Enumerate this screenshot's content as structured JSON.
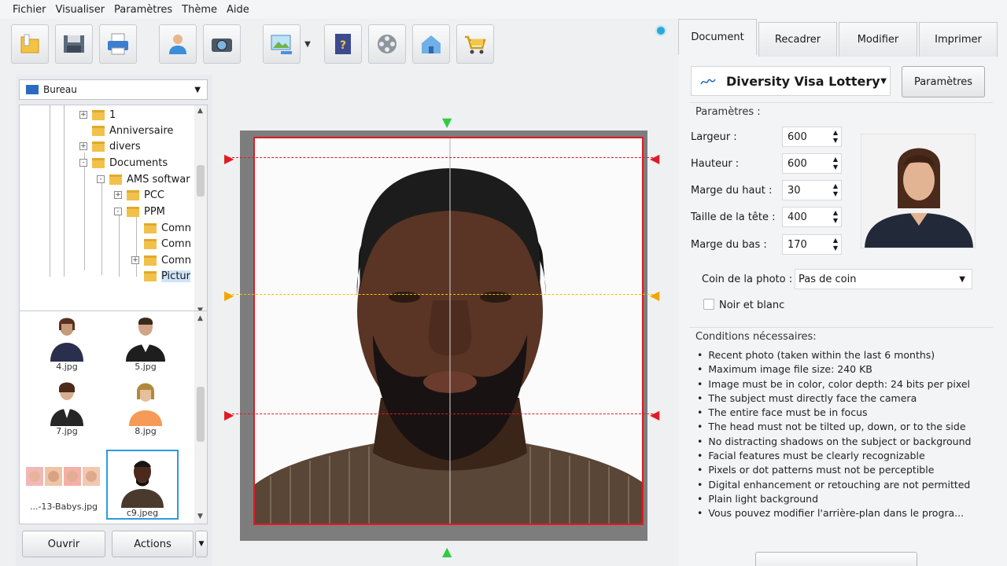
{
  "menu": [
    "Fichier",
    "Visualiser",
    "Paramètres",
    "Thème",
    "Aide"
  ],
  "toolbar": {
    "buttons": [
      "open-folder-icon",
      "save-icon",
      "print-icon",
      "person-icon",
      "camera-icon",
      "photo-edit-icon",
      "help-book-icon",
      "film-reel-icon",
      "home-icon",
      "cart-icon"
    ]
  },
  "left": {
    "location": "Bureau",
    "tree": [
      {
        "label": "1",
        "pm": "+"
      },
      {
        "label": "Anniversaire",
        "pm": ""
      },
      {
        "label": "divers",
        "pm": "+"
      },
      {
        "label": "Documents",
        "pm": "-"
      },
      {
        "label": "AMS softwar",
        "pm": "-"
      },
      {
        "label": "PCC",
        "pm": "+"
      },
      {
        "label": "PPM",
        "pm": "-"
      },
      {
        "label": "Comn",
        "pm": ""
      },
      {
        "label": "Comn",
        "pm": ""
      },
      {
        "label": "Comn",
        "pm": "+"
      },
      {
        "label": "Pictur",
        "pm": ""
      }
    ],
    "thumbnails": [
      "4.jpg",
      "5.jpg",
      "7.jpg",
      "8.jpg",
      "...-13-Babys.jpg",
      "c9.jpeg"
    ],
    "open_label": "Ouvrir",
    "actions_label": "Actions"
  },
  "right": {
    "tabs": [
      "Document",
      "Recadrer",
      "Modifier",
      "Imprimer"
    ],
    "document": "Diversity Visa Lottery",
    "params_button": "Paramètres",
    "params_title": "Paramètres :",
    "fields": [
      {
        "label": "Largeur :",
        "value": "600"
      },
      {
        "label": "Hauteur :",
        "value": "600"
      },
      {
        "label": "Marge du haut :",
        "value": "30"
      },
      {
        "label": "Taille de la tête :",
        "value": "400"
      },
      {
        "label": "Marge du bas :",
        "value": "170"
      }
    ],
    "corner_label": "Coin de la photo :",
    "corner_value": "Pas de coin",
    "bw_label": "Noir et blanc",
    "conditions_title": "Conditions nécessaires:",
    "conditions": [
      "Recent photo (taken within the last 6 months)",
      "Maximum image file size: 240 KB",
      "Image must be in color, color depth: 24 bits per pixel",
      "The subject must directly face the camera",
      "The entire face must be in focus",
      "The head must not be tilted up, down, or to the side",
      "No distracting shadows on the subject or background",
      "Facial features must be clearly recognizable",
      "Pixels or dot patterns must not be perceptible",
      "Digital enhancement or retouching are not permitted",
      "Plain light background",
      "Vous pouvez modifier l'arrière-plan dans le progra..."
    ]
  },
  "colors": {
    "accent": "#2a9be0",
    "guide_red": "#e01b24",
    "guide_yellow": "#f2c200",
    "marker_green": "#2ecc40"
  }
}
